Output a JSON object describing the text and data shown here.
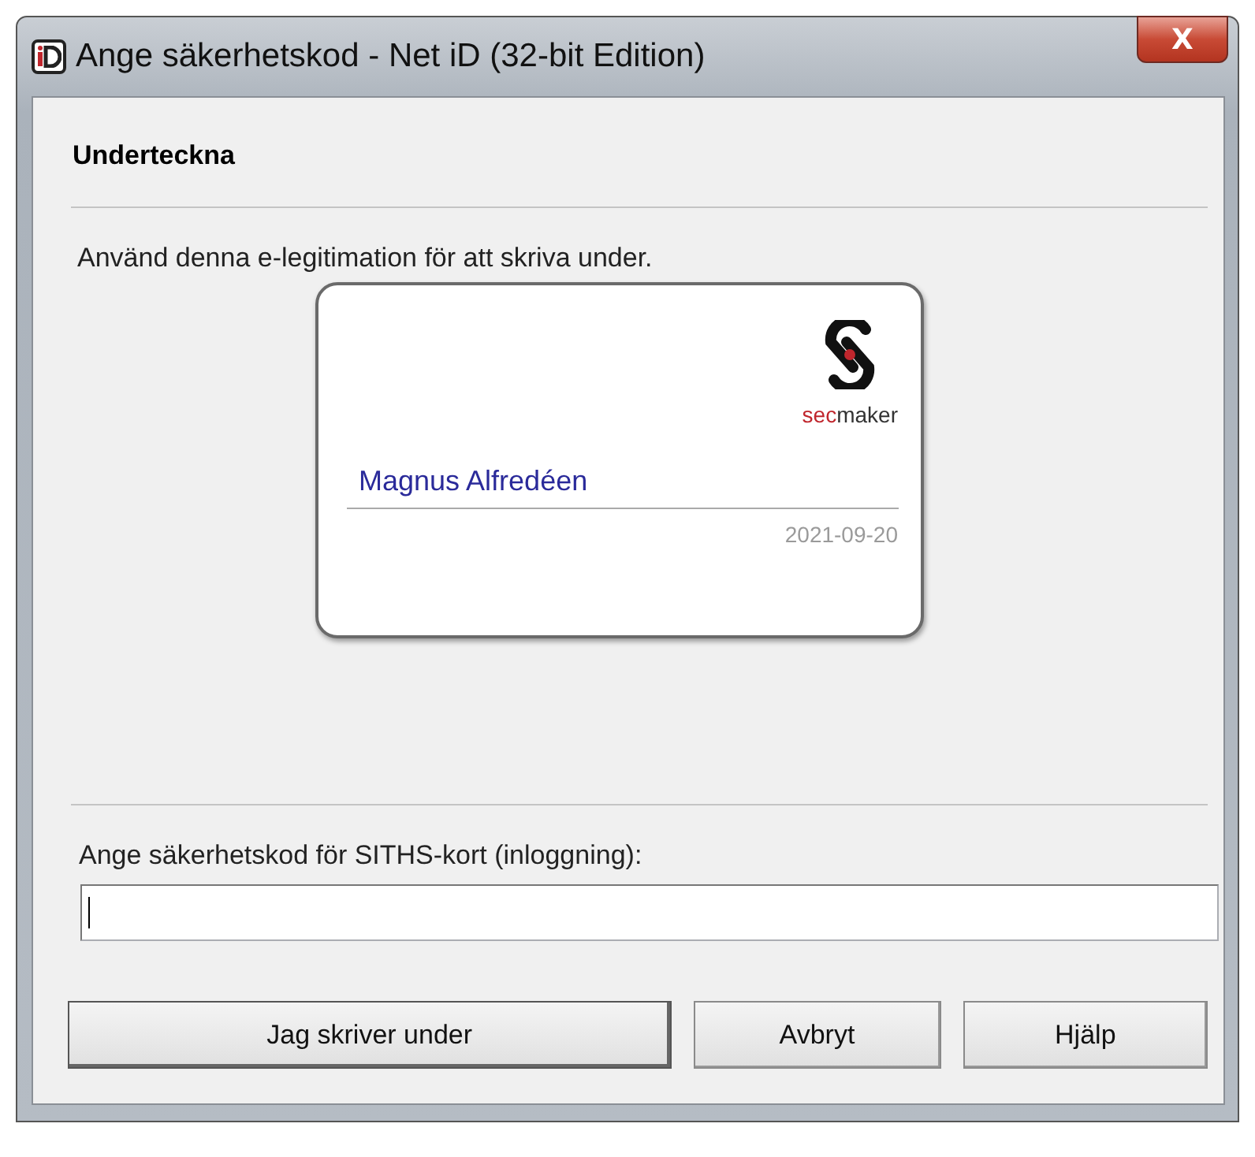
{
  "window": {
    "title": "Ange säkerhetskod - Net iD (32-bit Edition)",
    "close": "X"
  },
  "heading": "Underteckna",
  "instruction": "Använd denna e-legitimation för att skriva under.",
  "card": {
    "logo_accent": "sec",
    "logo_rest": "maker",
    "holder": "Magnus Alfredéen",
    "date": "2021-09-20"
  },
  "pin": {
    "label": "Ange säkerhetskod för SITHS-kort (inloggning):",
    "focused": true
  },
  "buttons": [
    {
      "label": "Jag skriver under",
      "default": true
    },
    {
      "label": "Avbryt",
      "default": false
    },
    {
      "label": "Hjälp",
      "default": false
    }
  ]
}
